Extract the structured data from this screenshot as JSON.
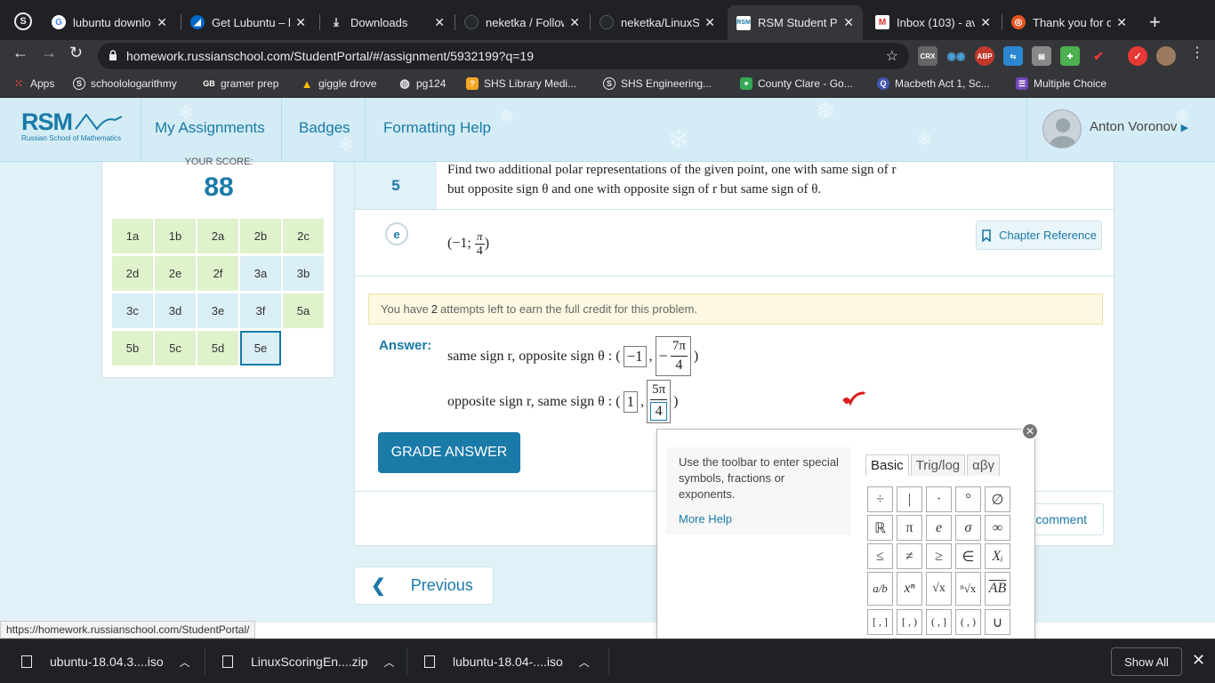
{
  "browser": {
    "tabs": [
      {
        "label": "lubuntu downlo",
        "icon": "google-icon",
        "active": false
      },
      {
        "label": "Get Lubuntu – l",
        "icon": "lubuntu-icon",
        "active": false
      },
      {
        "label": "Downloads",
        "icon": "download-icon",
        "active": false
      },
      {
        "label": "neketka / Follow",
        "icon": "github-icon",
        "active": false
      },
      {
        "label": "neketka/LinuxSc",
        "icon": "github-icon",
        "active": false
      },
      {
        "label": "RSM Student Po",
        "icon": "rsm-icon",
        "active": true
      },
      {
        "label": "Inbox (103) - av",
        "icon": "gmail-icon",
        "active": false
      },
      {
        "label": "Thank you for d",
        "icon": "ubuntu-icon",
        "active": false
      }
    ],
    "url": "homework.russianschool.com/StudentPortal/#/assignment/5932199?q=19",
    "extensions": [
      "CRX",
      "ABP"
    ],
    "bookmarks": [
      {
        "label": "Apps",
        "icon": "apps-icon"
      },
      {
        "label": "schoolologarithmy",
        "icon": "schoology-icon"
      },
      {
        "label": "gramer prep",
        "icon": "gb-icon"
      },
      {
        "label": "giggle drove",
        "icon": "drive-icon"
      },
      {
        "label": "pg124",
        "icon": "globe-icon"
      },
      {
        "label": "SHS Library Medi...",
        "icon": "library-icon"
      },
      {
        "label": "SHS Engineering...",
        "icon": "schoology-icon"
      },
      {
        "label": "County Clare - Go...",
        "icon": "maps-icon"
      },
      {
        "label": "Macbeth Act 1, Sc...",
        "icon": "quizlet-icon"
      },
      {
        "label": "Multiple Choice",
        "icon": "forms-icon"
      }
    ]
  },
  "rsm": {
    "logo_text": "RSM",
    "logo_sub": "Russian School of Mathematics",
    "nav": [
      "My Assignments",
      "Badges",
      "Formatting Help"
    ],
    "user_name": "Anton Voronov"
  },
  "score": {
    "label": "YOUR SCORE:",
    "value": "88",
    "cells": [
      {
        "label": "1a",
        "status": "green"
      },
      {
        "label": "1b",
        "status": "green"
      },
      {
        "label": "2a",
        "status": "green"
      },
      {
        "label": "2b",
        "status": "green"
      },
      {
        "label": "2c",
        "status": "green"
      },
      {
        "label": "2d",
        "status": "green"
      },
      {
        "label": "2e",
        "status": "green"
      },
      {
        "label": "2f",
        "status": "green"
      },
      {
        "label": "3a",
        "status": "blue"
      },
      {
        "label": "3b",
        "status": "blue"
      },
      {
        "label": "3c",
        "status": "blue"
      },
      {
        "label": "3d",
        "status": "blue"
      },
      {
        "label": "3e",
        "status": "blue"
      },
      {
        "label": "3f",
        "status": "blue"
      },
      {
        "label": "5a",
        "status": "green"
      },
      {
        "label": "5b",
        "status": "green"
      },
      {
        "label": "5c",
        "status": "green"
      },
      {
        "label": "5d",
        "status": "green"
      },
      {
        "label": "5e",
        "status": "active"
      }
    ]
  },
  "question": {
    "number": "5",
    "text_line1": "Find two additional polar representations of the given point, one with same sign of r",
    "text_line2": "but opposite sign θ and one with opposite sign of r but same sign of θ.",
    "part": "e",
    "point_prefix": "(−1; ",
    "point_num": "π",
    "point_den": "4",
    "point_suffix": ")",
    "chapter_ref": "Chapter Reference",
    "attempts_pre": "You have",
    "attempts_count": "2",
    "attempts_post": "attempts left to earn the full credit for this problem.",
    "answer_label": "Answer:",
    "line1_label": "same sign r, opposite sign θ : (",
    "line1_box1": "−1",
    "line1_num": "7π",
    "line1_den": "4",
    "line1_neg": "−",
    "line2_label": "opposite sign r, same sign θ : (",
    "line2_box1": "1",
    "line2_num": "5π",
    "line2_den": "4",
    "close_paren": ")",
    "comma": ",",
    "grade_button": "GRADE ANSWER",
    "comment_button": "comment",
    "previous_button": "Previous"
  },
  "math_panel": {
    "help_text": "Use the toolbar to enter special symbols, fractions or exponents.",
    "more_help": "More Help",
    "tabs": [
      "Basic",
      "Trig/log",
      "αβγ"
    ],
    "keys": [
      "÷",
      "|",
      "·",
      "°",
      "∅",
      "ℝ",
      "π",
      "e",
      "σ",
      "∞",
      "≤",
      "≠",
      "≥",
      "∈",
      "Xᵢ",
      "a/b",
      "xⁿ",
      "√x",
      "ⁿ√x",
      "AB",
      "[ , ]",
      "[ , )",
      "( , ]",
      "( , )",
      "∪"
    ]
  },
  "status_url": "https://homework.russianschool.com/StudentPortal/",
  "downloads": {
    "items": [
      "ubuntu-18.04.3....iso",
      "LinuxScoringEn....zip",
      "lubuntu-18.04-....iso"
    ],
    "show_all": "Show All"
  },
  "colors": {
    "brand": "#1a7aa8",
    "correct": "#d91f1f",
    "green_cell": "#dff2cc",
    "blue_cell": "#daeef5"
  }
}
